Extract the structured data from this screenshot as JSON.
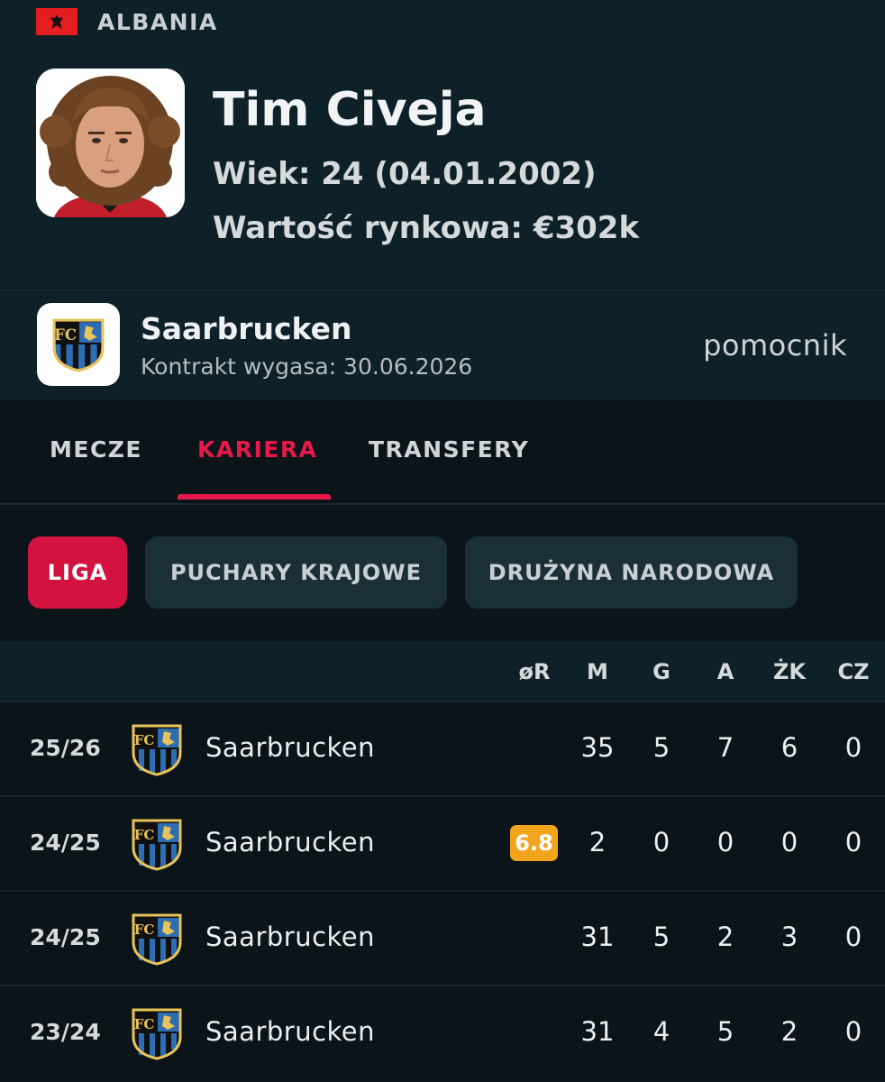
{
  "player": {
    "country": "ALBANIA",
    "name": "Tim Civeja",
    "age_line": "Wiek: 24 (04.01.2002)",
    "value_line": "Wartość rynkowa: €302k"
  },
  "club": {
    "name": "Saarbrucken",
    "contract": "Kontrakt wygasa: 30.06.2026",
    "position": "pomocnik"
  },
  "tabs": [
    {
      "label": "MECZE",
      "active": false
    },
    {
      "label": "KARIERA",
      "active": true
    },
    {
      "label": "TRANSFERY",
      "active": false
    }
  ],
  "filters": [
    {
      "label": "LIGA",
      "active": true
    },
    {
      "label": "PUCHARY KRAJOWE",
      "active": false
    },
    {
      "label": "DRUŻYNA NARODOWA",
      "active": false
    }
  ],
  "table": {
    "headers": [
      "øR",
      "M",
      "G",
      "A",
      "ŻK",
      "CZ"
    ],
    "rows": [
      {
        "season": "25/26",
        "team": "Saarbrucken",
        "rating": "",
        "m": "35",
        "g": "5",
        "a": "7",
        "zk": "6",
        "cz": "0"
      },
      {
        "season": "24/25",
        "team": "Saarbrucken",
        "rating": "6.8",
        "m": "2",
        "g": "0",
        "a": "0",
        "zk": "0",
        "cz": "0"
      },
      {
        "season": "24/25",
        "team": "Saarbrucken",
        "rating": "",
        "m": "31",
        "g": "5",
        "a": "2",
        "zk": "3",
        "cz": "0"
      },
      {
        "season": "23/24",
        "team": "Saarbrucken",
        "rating": "",
        "m": "31",
        "g": "4",
        "a": "5",
        "zk": "2",
        "cz": "0"
      }
    ]
  },
  "colors": {
    "accent": "#e8194a",
    "rating_badge": "#f0a51d",
    "header_bg": "#0f2128",
    "page_bg": "#0b1419"
  },
  "icons": {
    "flag": "albania-flag-icon",
    "club": "saarbrucken-crest-icon"
  }
}
